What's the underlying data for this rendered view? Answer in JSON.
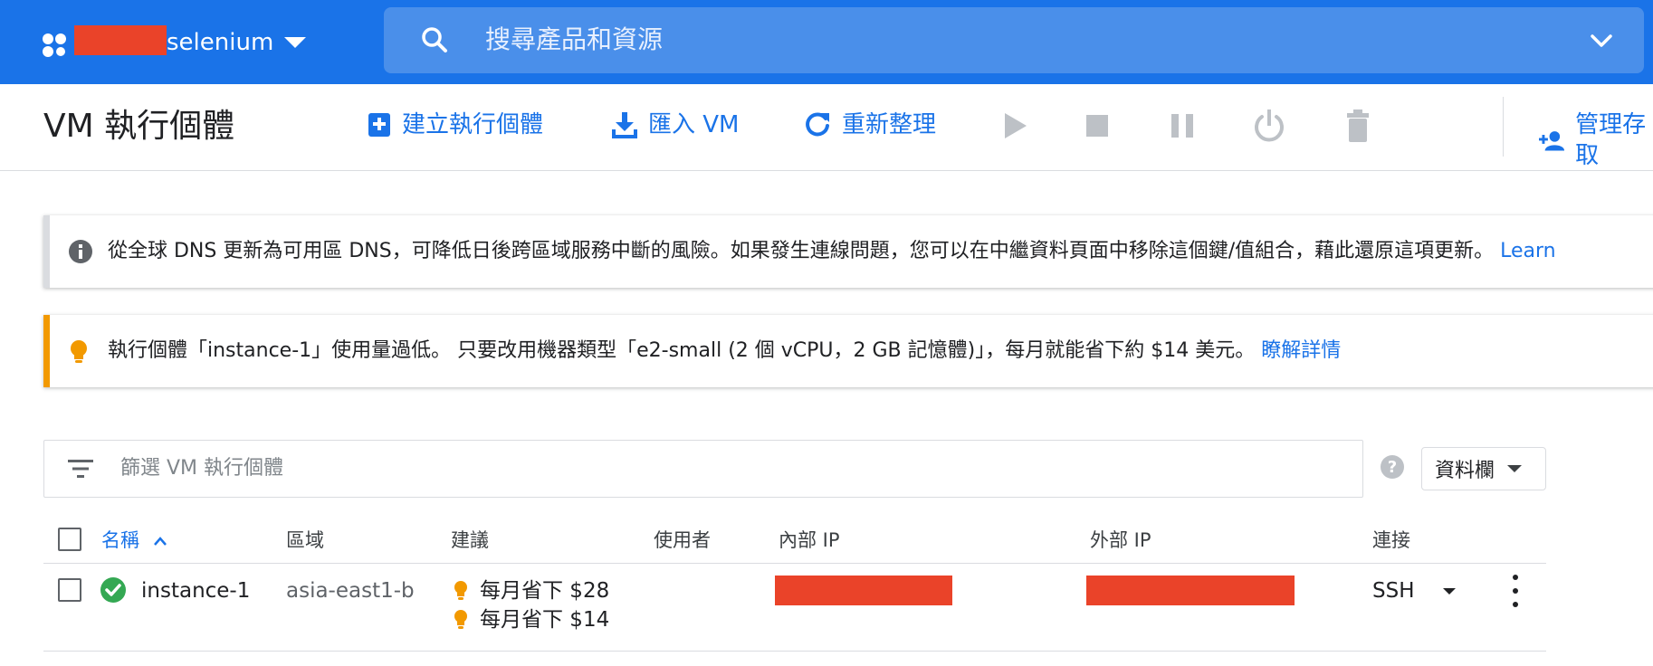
{
  "topbar": {
    "project_name": "selenium",
    "search_placeholder": "搜尋產品和資源"
  },
  "actionbar": {
    "title": "VM 執行個體",
    "create_label": "建立執行個體",
    "import_label": "匯入 VM",
    "refresh_label": "重新整理",
    "manage_access_label": "管理存取"
  },
  "dns_banner": {
    "text": "從全球 DNS 更新為可用區 DNS，可降低日後跨區域服務中斷的風險。如果發生連線問題，您可以在中繼資料頁面中移除這個鍵/值組合，藉此還原這項更新。",
    "link": "Learn"
  },
  "usage_banner": {
    "text": "執行個體「instance-1」使用量過低。 只要改用機器類型「e2-small (2 個 vCPU，2 GB 記憶體)」，每月就能省下約 $14 美元。",
    "link": "瞭解詳情"
  },
  "filter": {
    "placeholder": "篩選 VM 執行個體",
    "columns_label": "資料欄"
  },
  "table": {
    "columns": [
      "名稱",
      "區域",
      "建議",
      "使用者",
      "內部 IP",
      "外部 IP",
      "連接"
    ],
    "rows": [
      {
        "name": "instance-1",
        "zone": "asia-east1-b",
        "recommendations": [
          "每月省下 $28",
          "每月省下 $14"
        ],
        "user": "",
        "connect": "SSH"
      }
    ]
  },
  "colors": {
    "primary": "#1a73e8",
    "redaction": "#ea4329",
    "warning": "#f29900",
    "success": "#34a853"
  }
}
